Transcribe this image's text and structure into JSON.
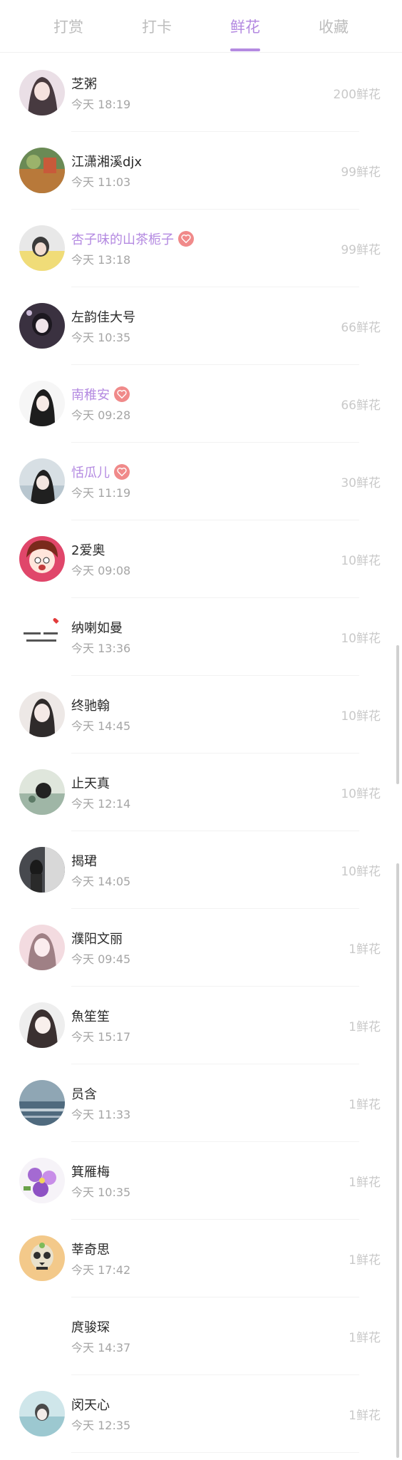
{
  "tabs": [
    {
      "label": "打赏",
      "active": false
    },
    {
      "label": "打卡",
      "active": false
    },
    {
      "label": "鲜花",
      "active": true
    },
    {
      "label": "收藏",
      "active": false
    }
  ],
  "accent_color": "#b48ae1",
  "badge_color": "#f08a8a",
  "rows": [
    {
      "name": "芝粥",
      "time": "今天 18:19",
      "flowers": "200鲜花",
      "vip": false
    },
    {
      "name": "江潇湘溪djx",
      "time": "今天 11:03",
      "flowers": "99鲜花",
      "vip": false
    },
    {
      "name": "杏子味的山茶栀子",
      "time": "今天 13:18",
      "flowers": "99鲜花",
      "vip": true
    },
    {
      "name": "左韵佳大号",
      "time": "今天 10:35",
      "flowers": "66鲜花",
      "vip": false
    },
    {
      "name": "南稚安",
      "time": "今天 09:28",
      "flowers": "66鲜花",
      "vip": true
    },
    {
      "name": "恬瓜儿",
      "time": "今天 11:19",
      "flowers": "30鲜花",
      "vip": true
    },
    {
      "name": "2爱奥",
      "time": "今天 09:08",
      "flowers": "10鲜花",
      "vip": false
    },
    {
      "name": "纳喇如曼",
      "time": "今天 13:36",
      "flowers": "10鲜花",
      "vip": false
    },
    {
      "name": "终驰翰",
      "time": "今天 14:45",
      "flowers": "10鲜花",
      "vip": false
    },
    {
      "name": "止天真",
      "time": "今天 12:14",
      "flowers": "10鲜花",
      "vip": false
    },
    {
      "name": "揭珺",
      "time": "今天 14:05",
      "flowers": "10鲜花",
      "vip": false
    },
    {
      "name": "濮阳文丽",
      "time": "今天 09:45",
      "flowers": "1鲜花",
      "vip": false
    },
    {
      "name": "魚笙笙",
      "time": "今天 15:17",
      "flowers": "1鲜花",
      "vip": false
    },
    {
      "name": "员含",
      "time": "今天 11:33",
      "flowers": "1鲜花",
      "vip": false
    },
    {
      "name": "箕雁梅",
      "time": "今天 10:35",
      "flowers": "1鲜花",
      "vip": false
    },
    {
      "name": "莘奇思",
      "time": "今天 17:42",
      "flowers": "1鲜花",
      "vip": false
    },
    {
      "name": "庹骏琛",
      "time": "今天 14:37",
      "flowers": "1鲜花",
      "vip": false
    },
    {
      "name": "闵天心",
      "time": "今天 12:35",
      "flowers": "1鲜花",
      "vip": false
    }
  ]
}
